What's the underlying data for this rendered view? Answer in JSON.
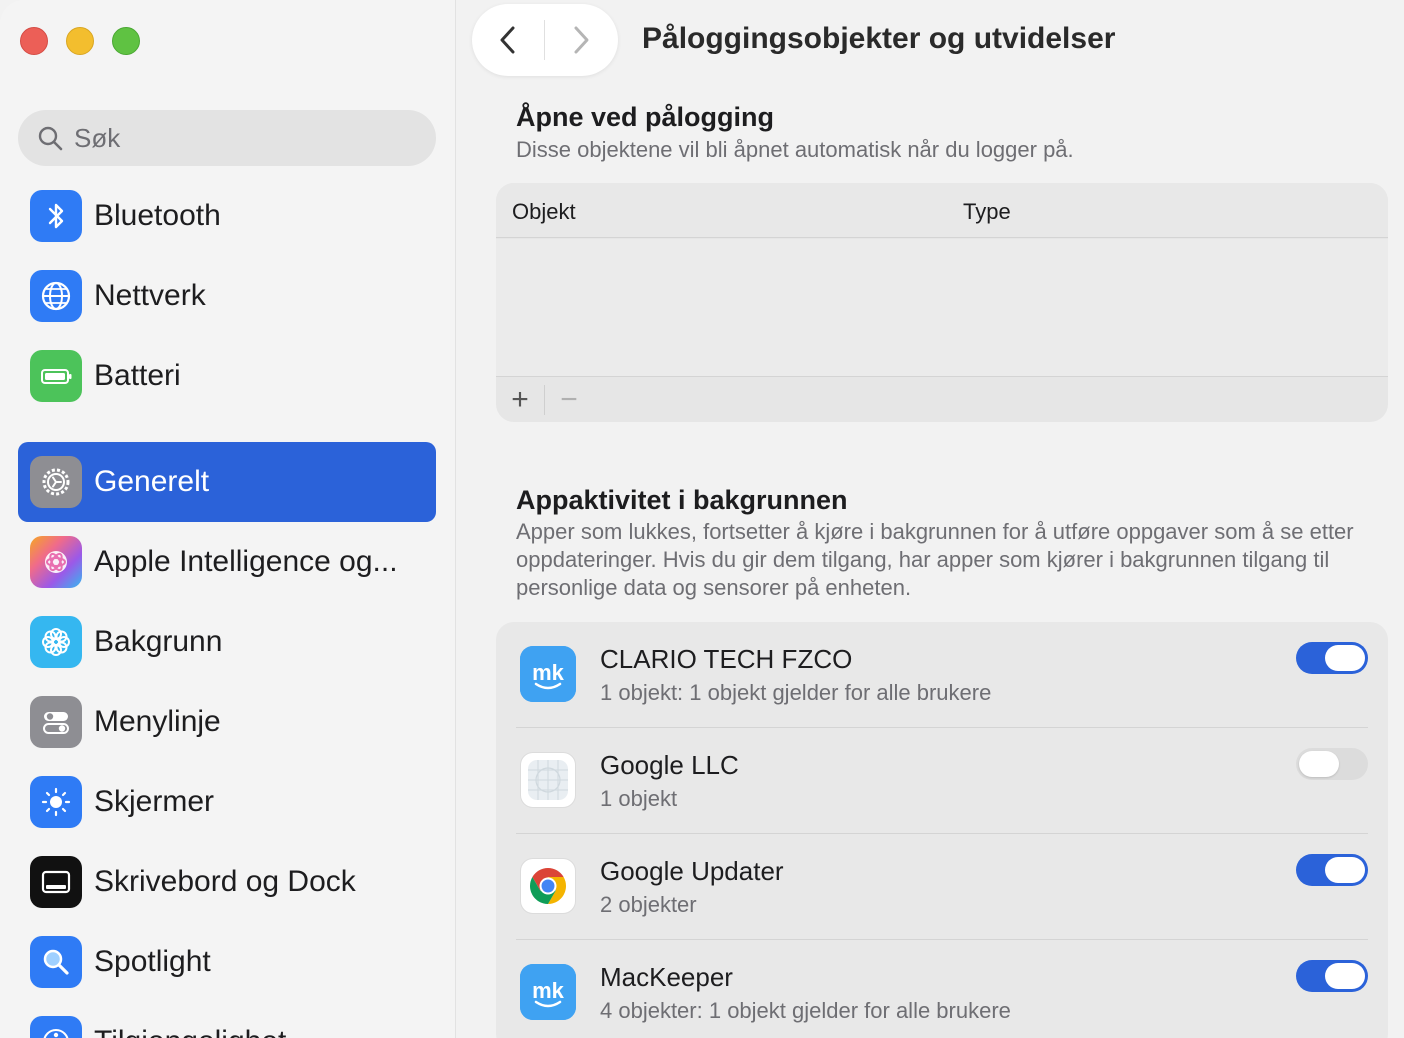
{
  "window": {
    "title": "Påloggingsobjekter og utvidelser"
  },
  "search": {
    "placeholder": "Søk"
  },
  "sidebar": {
    "items": [
      {
        "label": "Bluetooth",
        "icon": "bluetooth-icon",
        "color": "#2f7bf5"
      },
      {
        "label": "Nettverk",
        "icon": "globe-icon",
        "color": "#2f7bf5"
      },
      {
        "label": "Batteri",
        "icon": "battery-icon",
        "color": "#4cc35a"
      },
      {
        "label": "Generelt",
        "icon": "gear-icon",
        "color": "#8e8e93",
        "active": true
      },
      {
        "label": "Apple Intelligence og...",
        "icon": "apple-intelligence-icon",
        "color": "#f06b8a"
      },
      {
        "label": "Bakgrunn",
        "icon": "flower-icon",
        "color": "#35b7f0"
      },
      {
        "label": "Menylinje",
        "icon": "menubar-icon",
        "color": "#8e8e93"
      },
      {
        "label": "Skjermer",
        "icon": "sun-icon",
        "color": "#2f7bf5"
      },
      {
        "label": "Skrivebord og Dock",
        "icon": "dock-icon",
        "color": "#111111"
      },
      {
        "label": "Spotlight",
        "icon": "magnifier-icon",
        "color": "#2f7bf5"
      },
      {
        "label": "Tilgjengelighet",
        "icon": "accessibility-icon",
        "color": "#2f7bf5"
      }
    ]
  },
  "login": {
    "title": "Åpne ved pålogging",
    "desc": "Disse objektene vil bli åpnet automatisk når du logger på.",
    "col_object": "Objekt",
    "col_type": "Type",
    "add": "+",
    "remove": "−"
  },
  "background": {
    "title": "Appaktivitet i bakgrunnen",
    "desc": "Apper som lukkes, fortsetter å kjøre i bakgrunnen for å utføre oppgaver som å se etter oppdateringer. Hvis du gir dem tilgang, har apper som kjører i bakgrunnen tilgang til personlige data og sensorer på enheten.",
    "apps": [
      {
        "name": "CLARIO TECH FZCO",
        "sub": "1 objekt: 1 objekt gjelder for alle brukere",
        "enabled": true,
        "icon": "mackeeper-icon"
      },
      {
        "name": "Google LLC",
        "sub": "1 objekt",
        "enabled": false,
        "icon": "generic-app-icon"
      },
      {
        "name": "Google Updater",
        "sub": "2 objekter",
        "enabled": true,
        "icon": "chrome-icon"
      },
      {
        "name": "MacKeeper",
        "sub": "4 objekter: 1 objekt gjelder for alle brukere",
        "enabled": true,
        "icon": "mackeeper-icon"
      }
    ]
  },
  "colors": {
    "accent": "#2b62d9"
  }
}
